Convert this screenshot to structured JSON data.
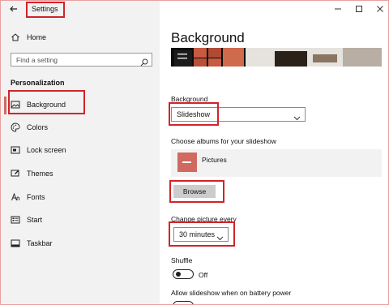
{
  "window": {
    "title": "Settings",
    "controls": [
      "minimize",
      "maximize",
      "close"
    ]
  },
  "sidebar": {
    "home_label": "Home",
    "search_placeholder": "Find a setting",
    "section_title": "Personalization",
    "items": [
      {
        "label": "Background",
        "icon": "picture-icon",
        "active": true
      },
      {
        "label": "Colors",
        "icon": "palette-icon",
        "active": false
      },
      {
        "label": "Lock screen",
        "icon": "lock-screen-icon",
        "active": false
      },
      {
        "label": "Themes",
        "icon": "brush-icon",
        "active": false
      },
      {
        "label": "Fonts",
        "icon": "font-icon",
        "active": false
      },
      {
        "label": "Start",
        "icon": "start-icon",
        "active": false
      },
      {
        "label": "Taskbar",
        "icon": "taskbar-icon",
        "active": false
      }
    ]
  },
  "main": {
    "title": "Background",
    "background_label": "Background",
    "background_value": "Slideshow",
    "albums_label": "Choose albums for your slideshow",
    "album_name": "Pictures",
    "browse_label": "Browse",
    "interval_label": "Change picture every",
    "interval_value": "30 minutes",
    "shuffle_label": "Shuffle",
    "shuffle_state": "Off",
    "battery_label": "Allow slideshow when on battery power"
  },
  "colors": {
    "accent": "#d06a5f",
    "highlight": "#d2232a",
    "sidebar_bg": "#f2f2f2"
  }
}
